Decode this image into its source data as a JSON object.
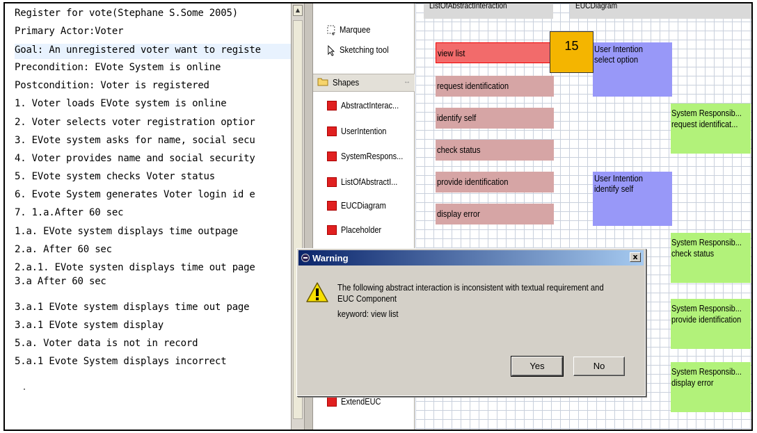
{
  "editor": {
    "lines": [
      {
        "text": "Register for vote(Stephane S.Some 2005)"
      },
      {
        "text": "Primary Actor:Voter"
      },
      {
        "text": "Goal: An unregistered voter want to registe"
      },
      {
        "text": "Precondition: EVote System is online"
      },
      {
        "text": "Postcondition: Voter is registered"
      },
      {
        "text": "1.  Voter loads EVote system is online"
      },
      {
        "text": "2.  Voter selects voter registration optior"
      },
      {
        "text": "3.  EVote system asks for name, social secu"
      },
      {
        "text": "4.  Voter provides name and social security"
      },
      {
        "text": "5.  EVote system checks Voter status"
      },
      {
        "text": "6.  Evote System generates Voter login id e"
      },
      {
        "text": "7.  1.a.After 60 sec"
      },
      {
        "text": "1.a. EVote system displays time outpage"
      },
      {
        "text": "2.a. After 60 sec"
      },
      {
        "text": "2.a.1. EVote systen displays time out page"
      },
      {
        "text": "3.a After 60 sec"
      },
      {
        "text": "3.a.1 EVote system displays time out page"
      },
      {
        "text": "3.a.1 EVote system display"
      },
      {
        "text": "5.a. Voter data is not in record"
      },
      {
        "text": "5.a.1 Evote System displays incorrect"
      }
    ]
  },
  "palette": {
    "marquee": "Marquee",
    "sketching": "Sketching tool",
    "shapes_header": "Shapes",
    "items": [
      "AbstractInterac...",
      "UserIntention",
      "SystemRespons...",
      "ListOfAbstractI...",
      "EUCDiagram",
      "Placeholder",
      "ExtendEUC"
    ]
  },
  "canvas": {
    "header_left": "ListOfAbstractInteraction",
    "header_right": "EUCDiagram",
    "abstract_interactions": [
      "view list",
      "request identification",
      "identify self",
      "check status",
      "provide identification",
      "display error"
    ],
    "user_intentions": [
      {
        "title": "User Intention",
        "label": "select option"
      },
      {
        "title": "User Intention",
        "label": "identify self"
      }
    ],
    "system_responsibilities": [
      {
        "title": "System Responsib...",
        "label": "request identificat..."
      },
      {
        "title": "System Responsib...",
        "label": "check status"
      },
      {
        "title": "System Responsib...",
        "label": "provide identification"
      },
      {
        "title": "System Responsib...",
        "label": "display error"
      }
    ],
    "badge": "15"
  },
  "dialog": {
    "title": "Warning",
    "close": "x",
    "message_line1": "The following abstract interaction is inconsistent with textual requirement and",
    "message_line2": "EUC Component",
    "keyword": "keyword: view list",
    "yes": "Yes",
    "no": "No"
  },
  "colors": {
    "abstract_interaction": "#d6a5a5",
    "selected_interaction": "#f26b6b",
    "user_intention": "#9898f8",
    "system_responsibility": "#b2f27a",
    "badge": "#f4b500",
    "shape_icon": "#e02020"
  }
}
